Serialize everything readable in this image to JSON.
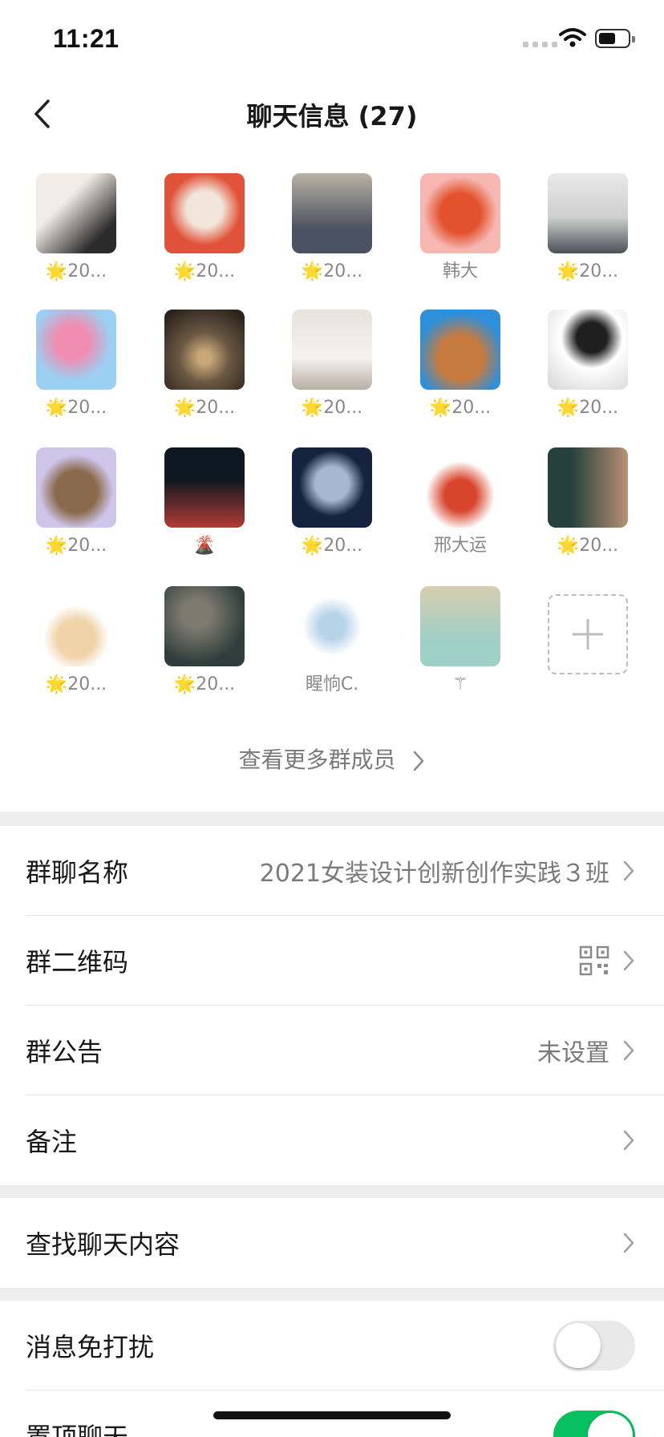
{
  "status_bar": {
    "time": "11:21"
  },
  "nav": {
    "title": "聊天信息 (27)"
  },
  "members": [
    {
      "name": "🌟20...",
      "colors": [
        "#f1ede6",
        "#2b2b2b"
      ]
    },
    {
      "name": "🌟20...",
      "colors": [
        "#e0533a",
        "#f2e6da"
      ]
    },
    {
      "name": "🌟20...",
      "colors": [
        "#4a5160",
        "#b9b2a6"
      ]
    },
    {
      "name": "韩大",
      "colors": [
        "#f6b7b3",
        "#e2532d"
      ]
    },
    {
      "name": "🌟20...",
      "colors": [
        "#e9e9e9",
        "#4b5158"
      ]
    },
    {
      "name": "🌟20...",
      "colors": [
        "#9bd0f2",
        "#f08db0"
      ]
    },
    {
      "name": "🌟20...",
      "colors": [
        "#6b5843",
        "#2a221b"
      ]
    },
    {
      "name": "🌟20...",
      "colors": [
        "#e6e2dc",
        "#b8aea4"
      ]
    },
    {
      "name": "🌟20...",
      "colors": [
        "#2f8fd9",
        "#c87b3e"
      ]
    },
    {
      "name": "🌟20...",
      "colors": [
        "#ffffff",
        "#1f1f1f"
      ]
    },
    {
      "name": "🌟20...",
      "colors": [
        "#cfc4ea",
        "#8a6a4c"
      ]
    },
    {
      "name": "🌋",
      "colors": [
        "#0e1820",
        "#b23a36"
      ]
    },
    {
      "name": "🌟20...",
      "colors": [
        "#15233f",
        "#a8b6d3"
      ]
    },
    {
      "name": "邢大运",
      "colors": [
        "#ffffff",
        "#d8452d"
      ]
    },
    {
      "name": "🌟20...",
      "colors": [
        "#26413a",
        "#b99178"
      ]
    },
    {
      "name": "🌟20...",
      "colors": [
        "#ffffff",
        "#f0d3a8"
      ]
    },
    {
      "name": "🌟20...",
      "colors": [
        "#2f3d3b",
        "#7d7a70"
      ]
    },
    {
      "name": "睲恦C.",
      "colors": [
        "#ffffff",
        "#b7d3e8"
      ]
    },
    {
      "name": "⚚",
      "colors": [
        "#9ed0c8",
        "#d8cdb0"
      ]
    }
  ],
  "more_members_label": "查看更多群成员",
  "settings": {
    "group_name": {
      "label": "群聊名称",
      "value": "2021女装设计创新创作实践３班"
    },
    "qr_code": {
      "label": "群二维码"
    },
    "announcement": {
      "label": "群公告",
      "value": "未设置"
    },
    "remark": {
      "label": "备注"
    },
    "search_chat": {
      "label": "查找聊天内容"
    },
    "mute": {
      "label": "消息免打扰",
      "enabled": false
    },
    "pin": {
      "label": "置顶聊天",
      "enabled": true
    }
  },
  "colors": {
    "accent": "#07c160",
    "page_bg": "#ededed"
  }
}
